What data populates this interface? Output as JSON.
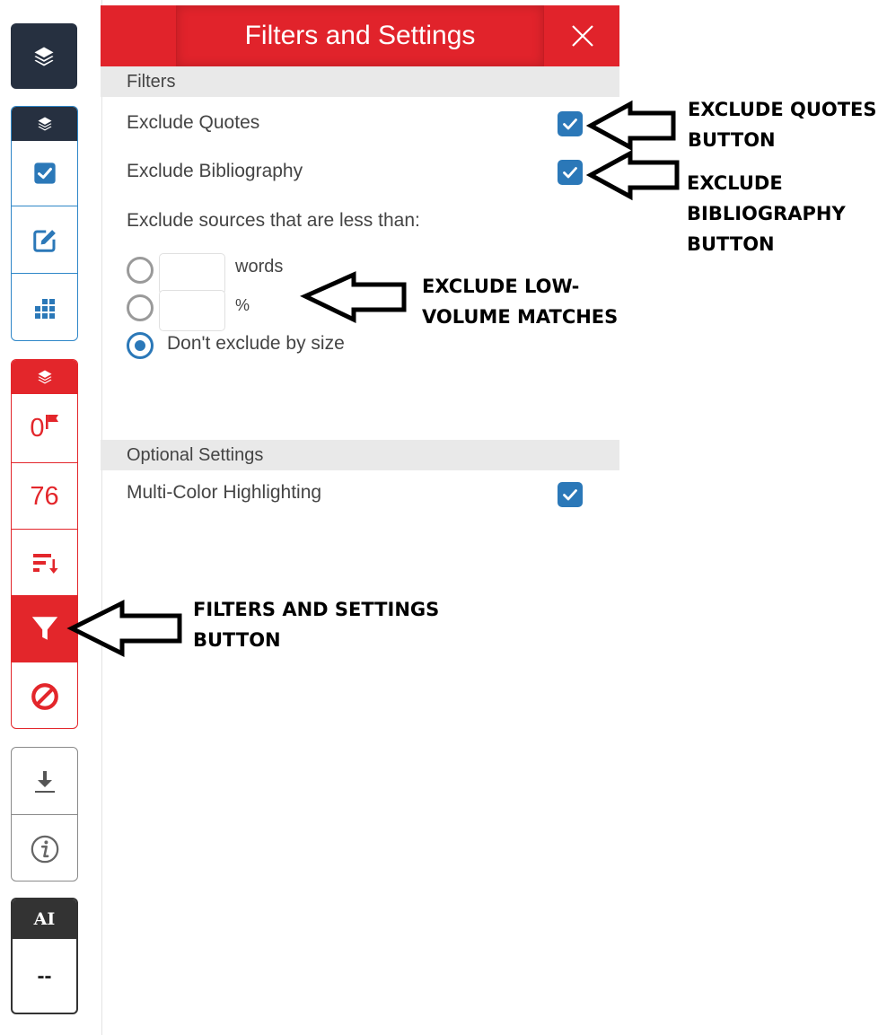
{
  "panel": {
    "title": "Filters and Settings",
    "close_glyph": "×",
    "filters_heading": "Filters",
    "exclude_quotes": {
      "label": "Exclude Quotes",
      "checked": true
    },
    "exclude_bibliography": {
      "label": "Exclude Bibliography",
      "checked": true
    },
    "exclude_sources_label": "Exclude sources that are less than:",
    "words_option": {
      "value": "",
      "unit": "words",
      "selected": false
    },
    "percent_option": {
      "value": "",
      "unit": "%",
      "selected": false
    },
    "dont_exclude_option": {
      "label": "Don't exclude by size",
      "selected": true
    },
    "optional_heading": "Optional Settings",
    "multi_color": {
      "label": "Multi-Color Highlighting",
      "checked": true
    }
  },
  "sidebar": {
    "flags_count": "0",
    "match_count": "76",
    "ai_label": "AI",
    "ai_score": "--"
  },
  "annotations": {
    "quotes_line1": "EXCLUDE QUOTES",
    "quotes_line2": "BUTTON",
    "bib_line1": "EXCLUDE",
    "bib_line2": "BIBLIOGRAPHY",
    "bib_line3": "BUTTON",
    "low_line1": "EXCLUDE LOW-",
    "low_line2": "VOLUME MATCHES",
    "filters_line1": "FILTERS AND SETTINGS",
    "filters_line2": "BUTTON"
  },
  "colors": {
    "brand_red": "#e1232b",
    "checkbox_blue": "#2b78b8",
    "navy": "#263040"
  },
  "icons": {
    "layers": "layers-icon",
    "checkbox": "checkbox-icon",
    "edit": "edit-icon",
    "grid": "grid-icon",
    "flag": "flag-icon",
    "sort": "sort-icon",
    "filter": "filter-icon",
    "ban": "ban-icon",
    "download": "download-icon",
    "info": "info-icon",
    "close": "close-icon"
  }
}
